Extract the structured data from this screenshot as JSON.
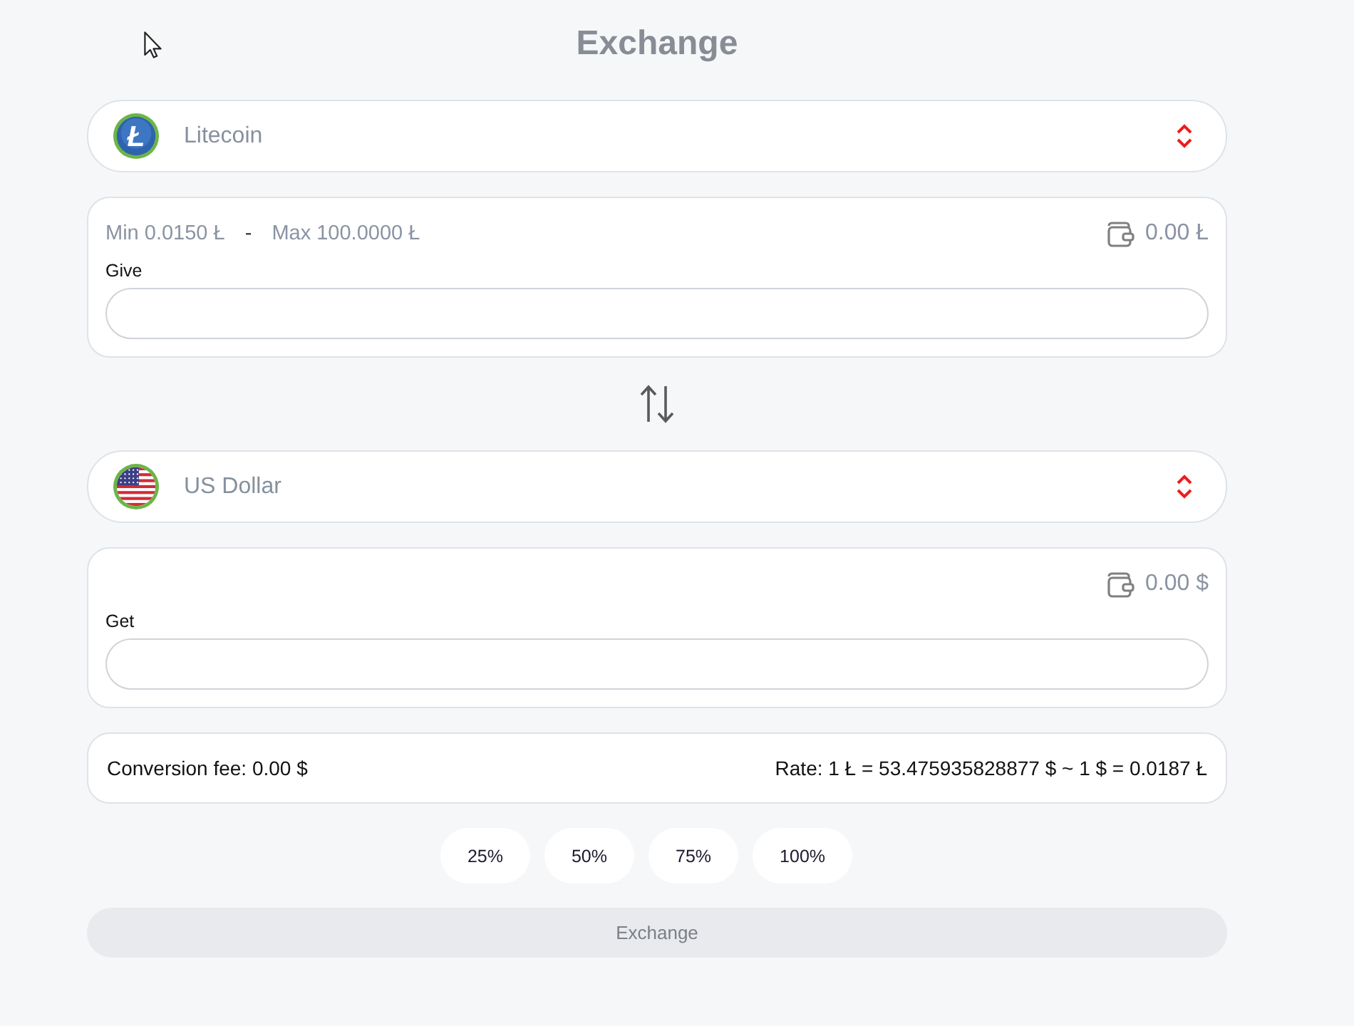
{
  "title": "Exchange",
  "give": {
    "currency": {
      "name": "Litecoin",
      "kind": "litecoin",
      "symbol": "Ł"
    },
    "limits": {
      "min": "Min 0.0150 Ł",
      "separator": "-",
      "max": "Max 100.0000 Ł"
    },
    "balance": "0.00 Ł",
    "label": "Give"
  },
  "get": {
    "currency": {
      "name": "US Dollar",
      "kind": "usd"
    },
    "balance": "0.00 $",
    "label": "Get"
  },
  "conversion": {
    "fee": "Conversion fee: 0.00 $",
    "rate": "Rate: 1 Ł = 53.475935828877 $ ~ 1 $ = 0.0187 Ł"
  },
  "percent_buttons": [
    "25%",
    "50%",
    "75%",
    "100%"
  ],
  "exchange_button": {
    "label": "Exchange",
    "disabled": true
  }
}
